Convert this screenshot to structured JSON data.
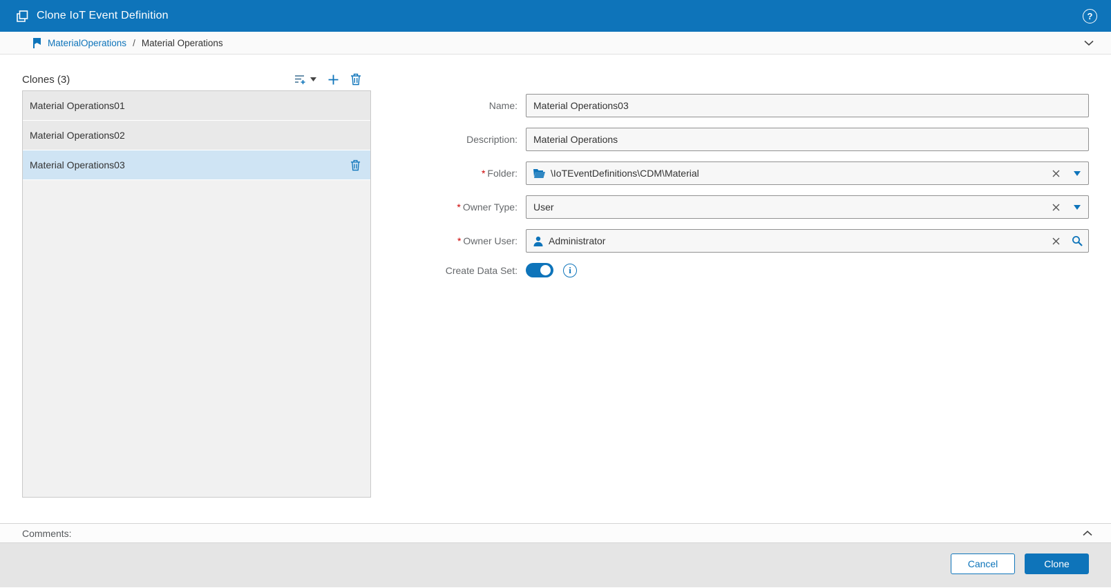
{
  "colors": {
    "accent": "#0e74ba",
    "selected_row": "#cfe4f4",
    "required_red": "#cc0000"
  },
  "title_bar": {
    "title": "Clone IoT Event Definition",
    "help_glyph": "?"
  },
  "breadcrumb": {
    "root": "MaterialOperations",
    "separator": "/",
    "current": "Material Operations"
  },
  "clones_panel": {
    "header": "Clones (3)",
    "items": [
      {
        "label": "Material Operations01",
        "selected": false
      },
      {
        "label": "Material Operations02",
        "selected": false
      },
      {
        "label": "Material Operations03",
        "selected": true
      }
    ]
  },
  "form": {
    "required_marker": "*",
    "name": {
      "label": "Name:",
      "value": "Material Operations03"
    },
    "description": {
      "label": "Description:",
      "value": "Material Operations"
    },
    "folder": {
      "label": "Folder:",
      "value": "\\IoTEventDefinitions\\CDM\\Material"
    },
    "owner_type": {
      "label": "Owner Type:",
      "value": "User"
    },
    "owner_user": {
      "label": "Owner User:",
      "value": "Administrator"
    },
    "create_data_set": {
      "label": "Create Data Set:",
      "state": "on",
      "info_glyph": "i"
    }
  },
  "comments": {
    "label": "Comments:"
  },
  "footer": {
    "cancel_label": "Cancel",
    "clone_label": "Clone"
  }
}
